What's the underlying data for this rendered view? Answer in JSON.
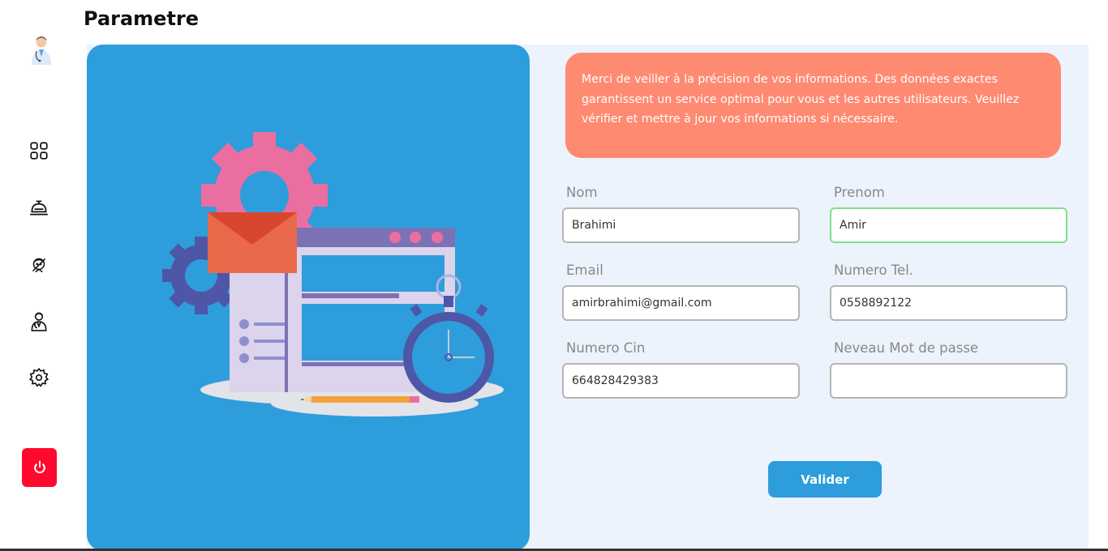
{
  "header": {
    "title": "Parametre"
  },
  "sidebar": {
    "items": [
      {
        "icon": "dashboard-icon"
      },
      {
        "icon": "service-bell-icon"
      },
      {
        "icon": "patient-icon"
      },
      {
        "icon": "doctor-icon"
      },
      {
        "icon": "settings-icon"
      }
    ],
    "logout_icon": "power-icon"
  },
  "notice": {
    "text": "Merci de veiller à la précision de vos informations. Des données exactes garantissent un service optimal pour vous et les autres utilisateurs. Veuillez vérifier et mettre à jour vos informations si nécessaire."
  },
  "form": {
    "nom": {
      "label": "Nom",
      "value": "Brahimi"
    },
    "prenom": {
      "label": "Prenom",
      "value": "Amir"
    },
    "email": {
      "label": "Email",
      "value": "amirbrahimi@gmail.com"
    },
    "tel": {
      "label": "Numero Tel.",
      "value": "0558892122"
    },
    "cin": {
      "label": "Numero Cin",
      "value": "664828429383"
    },
    "password": {
      "label": "Neveau Mot de passe",
      "value": ""
    },
    "submit_label": "Valider"
  },
  "colors": {
    "accent": "#2e9ddb",
    "notice": "#ff8a72",
    "danger": "#ff0a2e",
    "focus": "#7ee08a"
  }
}
